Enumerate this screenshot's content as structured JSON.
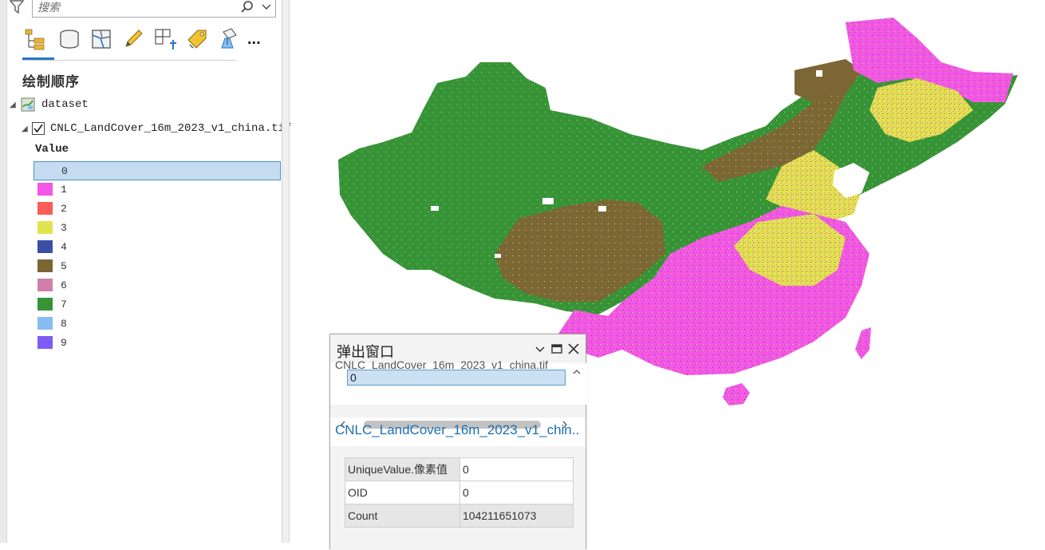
{
  "search": {
    "placeholder": "搜索"
  },
  "toolbar": {
    "items": [
      {
        "icon": "list-by-drawing-order-icon"
      },
      {
        "icon": "list-by-data-source-icon"
      },
      {
        "icon": "list-by-selection-icon"
      },
      {
        "icon": "list-by-editing-icon"
      },
      {
        "icon": "list-by-snapping-icon"
      },
      {
        "icon": "list-by-labeling-icon"
      },
      {
        "icon": "list-by-perspective-imagery-icon"
      }
    ],
    "more_label": "..."
  },
  "contents": {
    "section_title": "绘制顺序",
    "map_name": "dataset",
    "layer_name": "CNLC_LandCover_16m_2023_v1_china.tif",
    "field_heading": "Value",
    "legend": [
      {
        "label": "0",
        "color": null,
        "selected": true
      },
      {
        "label": "1",
        "color": "#f556e6"
      },
      {
        "label": "2",
        "color": "#fb5c56"
      },
      {
        "label": "3",
        "color": "#e2e34f"
      },
      {
        "label": "4",
        "color": "#3a4fa2"
      },
      {
        "label": "5",
        "color": "#7d6635"
      },
      {
        "label": "6",
        "color": "#cf7faa"
      },
      {
        "label": "7",
        "color": "#379436"
      },
      {
        "label": "8",
        "color": "#86bdf2"
      },
      {
        "label": "9",
        "color": "#7c5cf2"
      }
    ]
  },
  "popup": {
    "title": "弹出窗口",
    "list_cut_text": "CNLC_LandCover_16m_2023_v1_china.tif",
    "list_selected": "0",
    "feature_link": "CNLC_LandCover_16m_2023_v1_chin...",
    "attributes": [
      {
        "key": "UniqueValue.像素值",
        "value": "0"
      },
      {
        "key": "OID",
        "value": "0"
      },
      {
        "key": "Count",
        "value": "104211651073"
      }
    ]
  }
}
